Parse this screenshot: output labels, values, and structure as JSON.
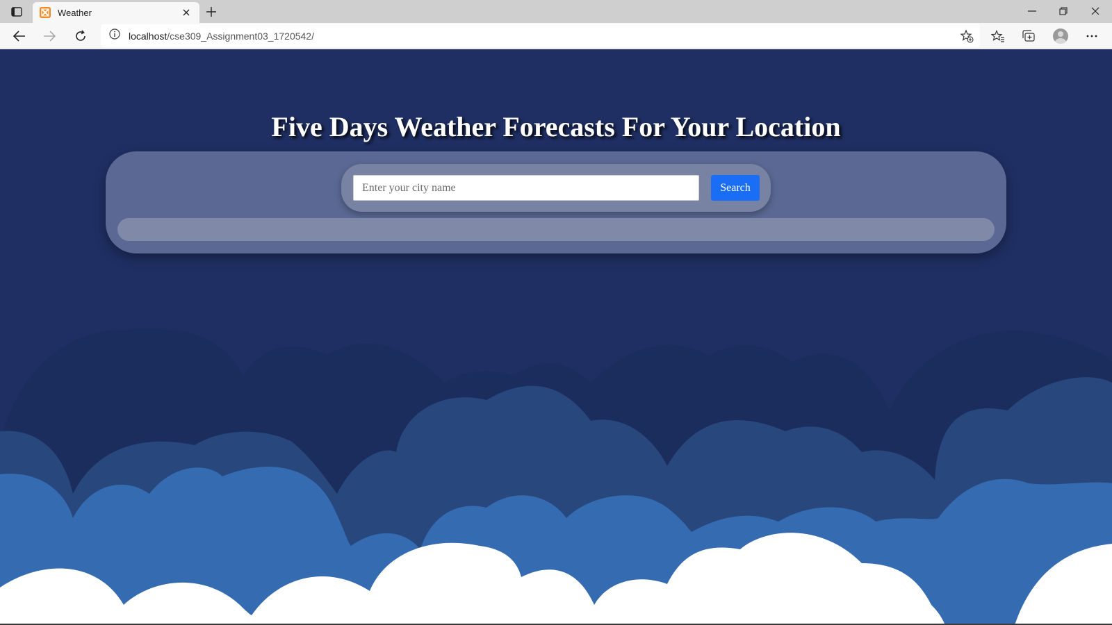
{
  "browser": {
    "tab_title": "Weather",
    "url_host": "localhost",
    "url_path": "/cse309_Assignment03_1720542/"
  },
  "page": {
    "heading": "Five Days Weather Forecasts For Your Location",
    "search": {
      "placeholder": "Enter your city name",
      "value": "",
      "button_label": "Search"
    }
  },
  "colors": {
    "background": "#1f2f63",
    "button": "#1a6ef5",
    "panel": "#5b6894",
    "cloud_dark": "#1b2d5c",
    "cloud_mid": "#27477d",
    "cloud_light": "#356bb0",
    "cloud_white": "#ffffff"
  },
  "icons": {
    "tab_actions": "tab-actions-icon",
    "favicon": "xampp-icon",
    "close": "close-icon",
    "new_tab": "plus-icon",
    "back": "arrow-left-icon",
    "forward": "arrow-right-icon",
    "refresh": "refresh-icon",
    "info": "info-icon",
    "add_favorite": "star-plus-icon",
    "favorites": "favorites-icon",
    "collections": "collections-icon",
    "profile": "profile-icon",
    "menu": "more-icon"
  }
}
